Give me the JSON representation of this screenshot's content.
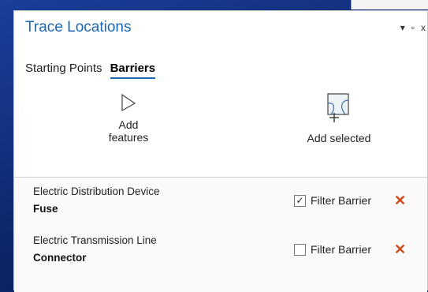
{
  "pane": {
    "title": "Trace Locations",
    "controls": {
      "dropdown": "▾",
      "maximize": "▫",
      "close": "x"
    }
  },
  "tabs": [
    {
      "label": "Starting Points",
      "active": false
    },
    {
      "label": "Barriers",
      "active": true
    }
  ],
  "tools": {
    "add_features": {
      "label_line1": "Add",
      "label_line2": "features",
      "icon": "arrow-pointer-icon"
    },
    "add_selected": {
      "label": "Add selected",
      "icon": "add-selected-icon"
    }
  },
  "barriers": [
    {
      "layer": "Electric Distribution Device",
      "feature": "Fuse",
      "filter_label": "Filter Barrier",
      "filter_checked": true,
      "check_glyph": "✓"
    },
    {
      "layer": "Electric Transmission Line",
      "feature": "Connector",
      "filter_label": "Filter Barrier",
      "filter_checked": false,
      "check_glyph": ""
    }
  ],
  "colors": {
    "accent": "#1b66b1",
    "delete": "#d14a16",
    "background": "#0d2a6e"
  },
  "delete_glyph": "✕"
}
